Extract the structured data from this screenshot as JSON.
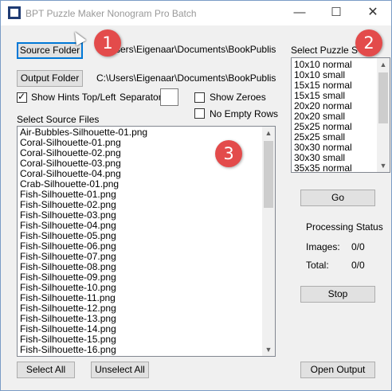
{
  "window": {
    "title": "BPT Puzzle Maker Nonogram Pro Batch",
    "minimize_icon": "minimize-icon",
    "maximize_icon": "maximize-icon",
    "close_icon": "close-icon",
    "min_glyph": "—",
    "max_glyph": "☐",
    "close_glyph": "✕"
  },
  "source_folder": {
    "button_label": "Source Folder",
    "path": "C:\\Users\\Eigenaar\\Documents\\BookPublisher"
  },
  "output_folder": {
    "button_label": "Output Folder",
    "path": "C:\\Users\\Eigenaar\\Documents\\BookPublisher"
  },
  "options": {
    "show_hints_label": "Show Hints Top/Left",
    "show_hints_checked": true,
    "separator_label": "Separator",
    "separator_value": "",
    "show_zeroes_label": "Show Zeroes",
    "show_zeroes_checked": false,
    "no_empty_rows_label": "No Empty Rows",
    "no_empty_rows_checked": false
  },
  "puzzle_size": {
    "label": "Select Puzzle Size",
    "items": [
      "10x10 normal",
      "10x10 small",
      "15x15 normal",
      "15x15 small",
      "20x20 normal",
      "20x20 small",
      "25x25 normal",
      "25x25 small",
      "30x30 normal",
      "30x30 small",
      "35x35 normal"
    ]
  },
  "source_files": {
    "label": "Select Source Files",
    "items": [
      "Air-Bubbles-Silhouette-01.png",
      "Coral-Silhouette-01.png",
      "Coral-Silhouette-02.png",
      "Coral-Silhouette-03.png",
      "Coral-Silhouette-04.png",
      "Crab-Silhouette-01.png",
      "Fish-Silhouette-01.png",
      "Fish-Silhouette-02.png",
      "Fish-Silhouette-03.png",
      "Fish-Silhouette-04.png",
      "Fish-Silhouette-05.png",
      "Fish-Silhouette-06.png",
      "Fish-Silhouette-07.png",
      "Fish-Silhouette-08.png",
      "Fish-Silhouette-09.png",
      "Fish-Silhouette-10.png",
      "Fish-Silhouette-11.png",
      "Fish-Silhouette-12.png",
      "Fish-Silhouette-13.png",
      "Fish-Silhouette-14.png",
      "Fish-Silhouette-15.png",
      "Fish-Silhouette-16.png"
    ],
    "select_all_label": "Select All",
    "unselect_all_label": "Unselect All"
  },
  "processing": {
    "go_label": "Go",
    "status_label": "Processing Status",
    "images_label": "Images:",
    "images_value": "0/0",
    "total_label": "Total:",
    "total_value": "0/0",
    "stop_label": "Stop",
    "open_output_label": "Open Output"
  },
  "annotations": [
    "1",
    "2",
    "3"
  ],
  "colors": {
    "badge": "#e34b4b",
    "focus_border": "#0078d7"
  }
}
